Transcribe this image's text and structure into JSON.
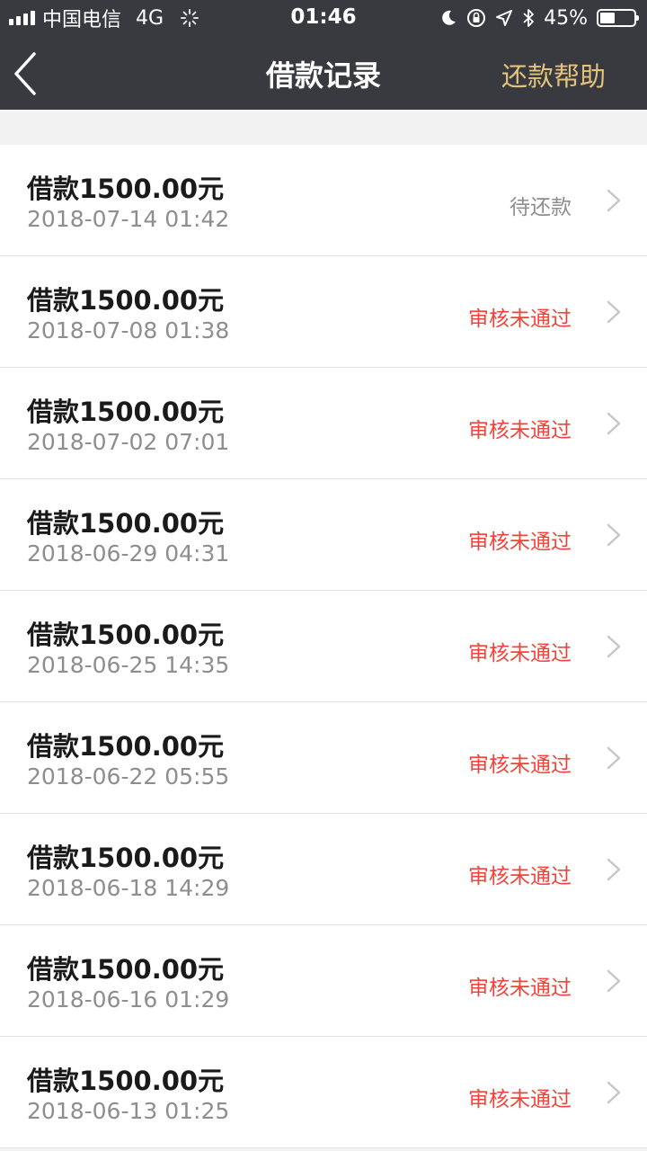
{
  "status_bar": {
    "carrier": "中国电信",
    "network": "4G",
    "time": "01:46",
    "battery": "45%",
    "battery_level": 0.45
  },
  "nav": {
    "back_icon": "chevron-left-icon",
    "title": "借款记录",
    "help_link": "还款帮助"
  },
  "colors": {
    "header_bg": "#393a3f",
    "help_link": "#e2c27d",
    "status_pending": "#8e8e8e",
    "status_rejected": "#f0443a"
  },
  "records": [
    {
      "amount": "借款1500.00元",
      "date": "2018-07-14 01:42",
      "status": "待还款",
      "status_type": "pending"
    },
    {
      "amount": "借款1500.00元",
      "date": "2018-07-08 01:38",
      "status": "审核未通过",
      "status_type": "rejected"
    },
    {
      "amount": "借款1500.00元",
      "date": "2018-07-02 07:01",
      "status": "审核未通过",
      "status_type": "rejected"
    },
    {
      "amount": "借款1500.00元",
      "date": "2018-06-29 04:31",
      "status": "审核未通过",
      "status_type": "rejected"
    },
    {
      "amount": "借款1500.00元",
      "date": "2018-06-25 14:35",
      "status": "审核未通过",
      "status_type": "rejected"
    },
    {
      "amount": "借款1500.00元",
      "date": "2018-06-22 05:55",
      "status": "审核未通过",
      "status_type": "rejected"
    },
    {
      "amount": "借款1500.00元",
      "date": "2018-06-18 14:29",
      "status": "审核未通过",
      "status_type": "rejected"
    },
    {
      "amount": "借款1500.00元",
      "date": "2018-06-16 01:29",
      "status": "审核未通过",
      "status_type": "rejected"
    },
    {
      "amount": "借款1500.00元",
      "date": "2018-06-13 01:25",
      "status": "审核未通过",
      "status_type": "rejected"
    }
  ]
}
